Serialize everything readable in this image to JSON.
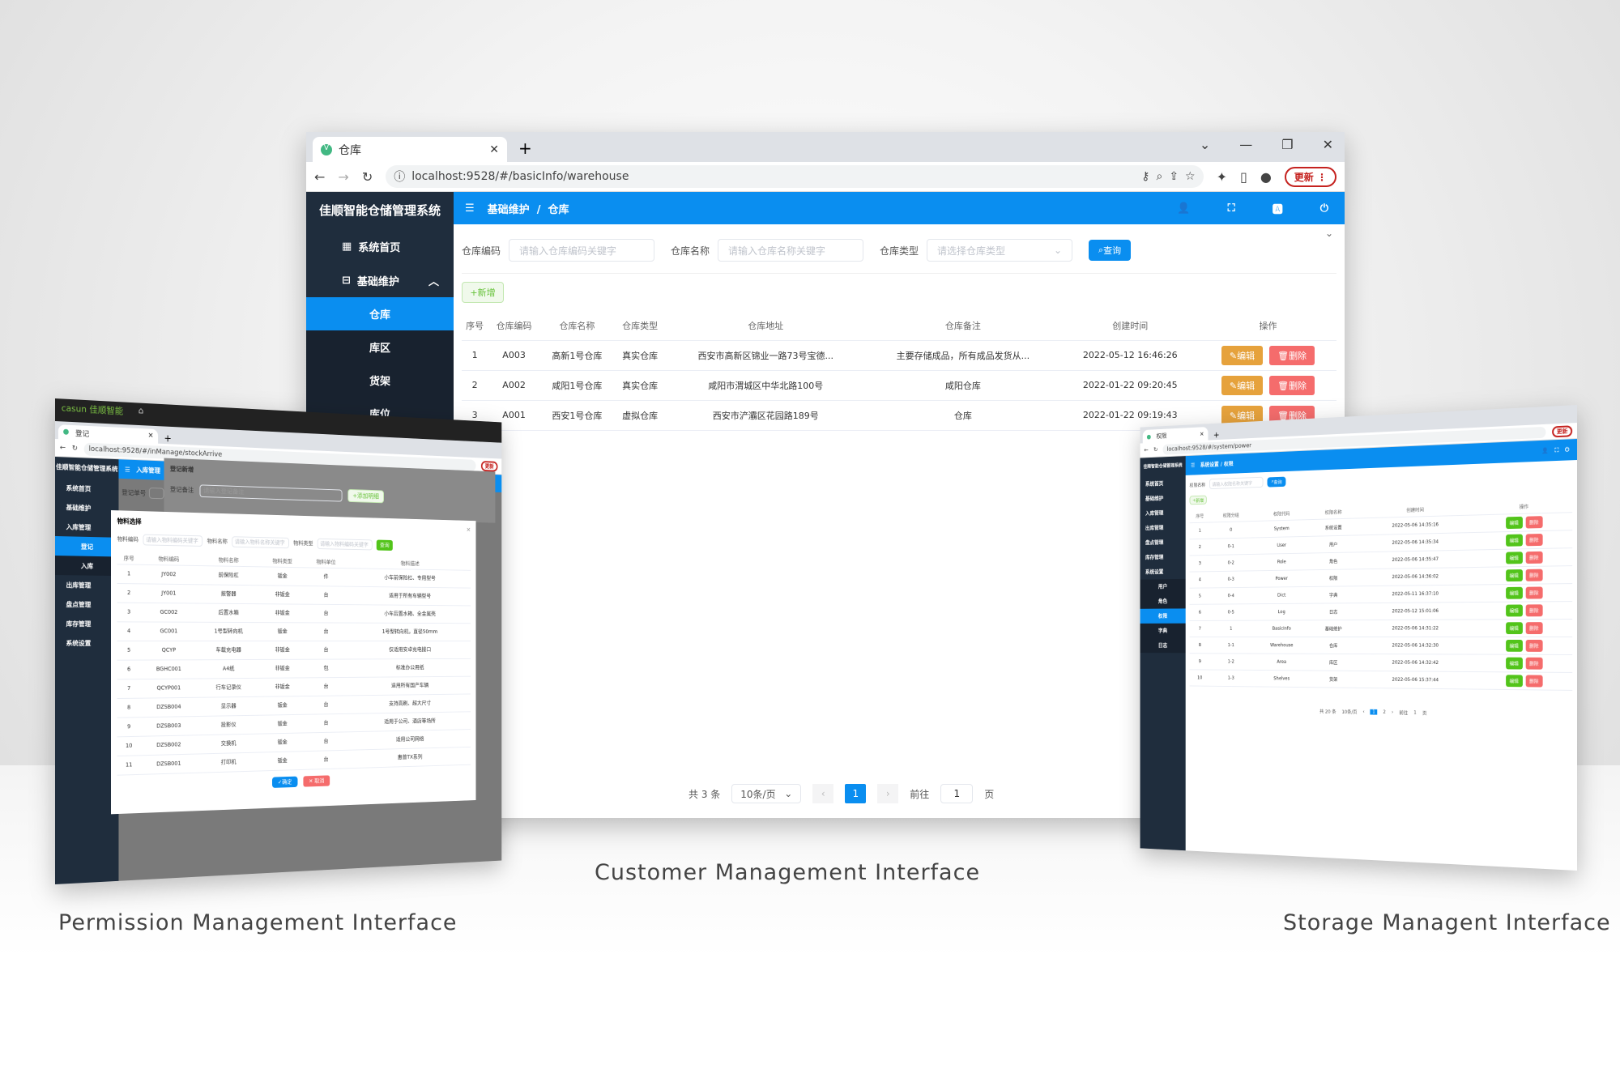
{
  "captions": {
    "left": "Permission Management Interface",
    "center": "Customer Management Interface",
    "right": "Storage Managent Interface"
  },
  "colors": {
    "primary": "#0a8ef0",
    "sidebar": "#1f2d3d",
    "edit": "#e6a23c",
    "edit_green": "#52c41a",
    "delete": "#f56c6c"
  },
  "center": {
    "tab_title": "仓库",
    "url": "localhost:9528/#/basicInfo/warehouse",
    "update_label": "更新",
    "app_title": "佳顺智能仓储管理系统",
    "sidebar": [
      {
        "label": "系统首页",
        "icon": "grid-icon"
      },
      {
        "label": "基础维护",
        "icon": "monitor-icon"
      }
    ],
    "submenu": [
      "仓库",
      "库区",
      "货架",
      "库位"
    ],
    "breadcrumb": [
      "基础维护",
      "仓库"
    ],
    "filters": [
      {
        "label": "仓库编码",
        "placeholder": "请输入仓库编码关键字"
      },
      {
        "label": "仓库名称",
        "placeholder": "请输入仓库名称关键字"
      },
      {
        "label": "仓库类型",
        "placeholder": "请选择仓库类型"
      }
    ],
    "query_label": "查询",
    "add_label": "新增",
    "columns": [
      "序号",
      "仓库编码",
      "仓库名称",
      "仓库类型",
      "仓库地址",
      "仓库备注",
      "创建时间",
      "操作"
    ],
    "rows": [
      [
        "1",
        "A003",
        "高新1号仓库",
        "真实仓库",
        "西安市高新区锦业一路73号宝德...",
        "主要存储成品，所有成品发货从...",
        "2022-05-12 16:46:26"
      ],
      [
        "2",
        "A002",
        "咸阳1号仓库",
        "真实仓库",
        "咸阳市渭城区中华北路100号",
        "咸阳仓库",
        "2022-01-22 09:20:45"
      ],
      [
        "3",
        "A001",
        "西安1号仓库",
        "虚拟仓库",
        "西安市浐灞区花园路189号",
        "仓库",
        "2022-01-22 09:19:43"
      ]
    ],
    "edit_label": "编辑",
    "delete_label": "删除",
    "pagination": {
      "total": "共 3 条",
      "page_size": "10条/页",
      "current": "1",
      "goto": "前往",
      "goto_value": "1",
      "page_unit": "页"
    }
  },
  "left": {
    "brand": "casun 佳顺智能",
    "tab_title": "登记",
    "url": "localhost:9528/#/inManage/stockArrive",
    "update_label": "更新",
    "app_title": "佳顺智能仓储管理系统",
    "sidebar": [
      "系统首页",
      "基础维护",
      "入库管理",
      "登记",
      "入库",
      "出库管理",
      "盘点管理",
      "库存管理",
      "系统设置"
    ],
    "breadcrumb": "入库管理",
    "bg_dialog": {
      "title": "登记新增",
      "field1": "登记单号",
      "field2": "登记备注",
      "placeholder": "请输入登记备注",
      "add_detail": "添加明细"
    },
    "modal": {
      "title": "物料选择",
      "filters": [
        {
          "label": "物料编码",
          "placeholder": "请输入物料编码关键字"
        },
        {
          "label": "物料名称",
          "placeholder": "请输入物料名称关键字"
        },
        {
          "label": "物料类型",
          "placeholder": "请输入物料编码关键字"
        }
      ],
      "query_label": "查询",
      "columns": [
        "序号",
        "物料编码",
        "物料名称",
        "物料类型",
        "物料单位",
        "物料描述"
      ],
      "rows": [
        [
          "1",
          "JY002",
          "前保险杠",
          "钣金",
          "件",
          "小车前保险杠、专用型号"
        ],
        [
          "2",
          "JY001",
          "报警器",
          "非钣金",
          "台",
          "适用于所有车辆型号"
        ],
        [
          "3",
          "GC002",
          "后置水箱",
          "非钣金",
          "台",
          "小车后置水箱、全金属壳"
        ],
        [
          "4",
          "GC001",
          "1号型转向机",
          "钣金",
          "台",
          "1号型转向机，直径50mm"
        ],
        [
          "5",
          "QCYP",
          "车载充电器",
          "非钣金",
          "台",
          "仅适用安卓充电接口"
        ],
        [
          "6",
          "BGHC001",
          "A4纸",
          "非钣金",
          "包",
          "标准办公用纸"
        ],
        [
          "7",
          "QCYP001",
          "行车记录仪",
          "非钣金",
          "台",
          "适用所有国产车辆"
        ],
        [
          "8",
          "DZSB004",
          "显示器",
          "钣金",
          "台",
          "支持高刷、超大尺寸"
        ],
        [
          "9",
          "DZSB003",
          "投影仪",
          "钣金",
          "台",
          "适用于公司、酒店等场所"
        ],
        [
          "10",
          "DZSB002",
          "交换机",
          "钣金",
          "台",
          "适用公司网络"
        ],
        [
          "11",
          "DZSB001",
          "打印机",
          "钣金",
          "台",
          "惠普TX系列"
        ]
      ],
      "confirm_label": "确定",
      "cancel_label": "取消"
    }
  },
  "right": {
    "tab_title": "权限",
    "url": "localhost:9528/#/system/power",
    "update_label": "更新",
    "app_title": "佳顺智能仓储管理系统",
    "sidebar": [
      "系统首页",
      "基础维护",
      "入库管理",
      "出库管理",
      "盘点管理",
      "库存管理",
      "系统设置"
    ],
    "submenu": [
      "用户",
      "角色",
      "权限",
      "字典",
      "日志"
    ],
    "breadcrumb": [
      "系统设置",
      "权限"
    ],
    "filter": {
      "label": "权限名称",
      "placeholder": "请输入权限名称关键字"
    },
    "query_label": "查询",
    "add_label": "新增",
    "columns": [
      "序号",
      "权限分组",
      "权限代码",
      "权限名称",
      "创建时间",
      "操作"
    ],
    "rows": [
      [
        "1",
        "0",
        "System",
        "系统设置",
        "2022-05-06 14:35:16"
      ],
      [
        "2",
        "0-1",
        "User",
        "用户",
        "2022-05-06 14:35:34"
      ],
      [
        "3",
        "0-2",
        "Role",
        "角色",
        "2022-05-06 14:35:47"
      ],
      [
        "4",
        "0-3",
        "Power",
        "权限",
        "2022-05-06 14:36:02"
      ],
      [
        "5",
        "0-4",
        "Dict",
        "字典",
        "2022-05-11 16:37:10"
      ],
      [
        "6",
        "0-5",
        "Log",
        "日志",
        "2022-05-12 15:01:06"
      ],
      [
        "7",
        "1",
        "BasicInfo",
        "基础维护",
        "2022-05-06 14:31:22"
      ],
      [
        "8",
        "1-1",
        "Warehouse",
        "仓库",
        "2022-05-06 14:32:30"
      ],
      [
        "9",
        "1-2",
        "Area",
        "库区",
        "2022-05-06 14:32:42"
      ],
      [
        "10",
        "1-3",
        "Shelves",
        "货架",
        "2022-05-06 15:37:44"
      ]
    ],
    "edit_label": "编辑",
    "delete_label": "删除",
    "pagination": {
      "total": "共 20 条",
      "page_size": "10条/页",
      "pages": [
        "1",
        "2"
      ],
      "goto": "前往",
      "goto_value": "1",
      "page_unit": "页"
    }
  }
}
